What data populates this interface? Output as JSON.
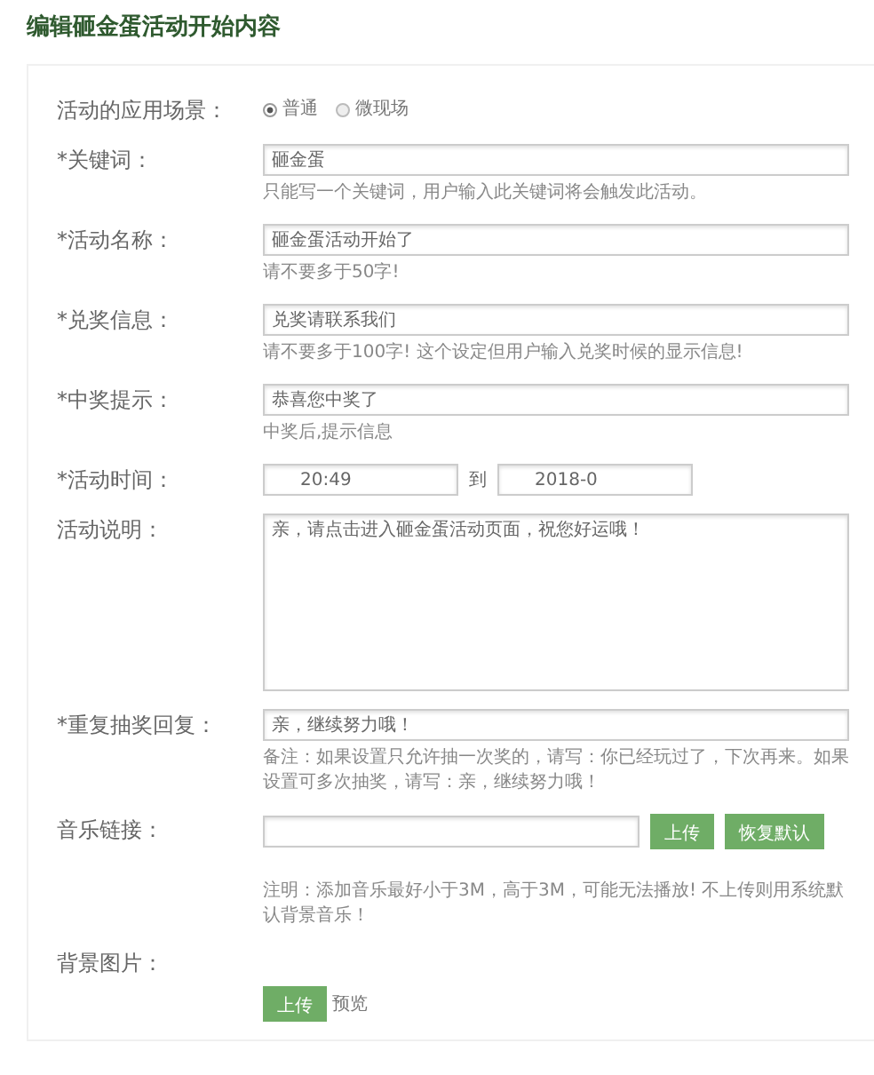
{
  "title": "编辑砸金蛋活动开始内容",
  "scene": {
    "label": "活动的应用场景：",
    "options": [
      {
        "label": "普通",
        "selected": true
      },
      {
        "label": "微现场",
        "selected": false
      }
    ]
  },
  "fields": [
    {
      "kind": "text",
      "label": "*关键词：",
      "value": "砸金蛋",
      "hint": "只能写一个关键词，用户输入此关键词将会触发此活动。"
    },
    {
      "kind": "text",
      "label": "*活动名称：",
      "value": "砸金蛋活动开始了",
      "hint": "请不要多于50字!"
    },
    {
      "kind": "text",
      "label": "*兑奖信息：",
      "value": "兑奖请联系我们",
      "hint": "请不要多于100字! 这个设定但用户输入兑奖时候的显示信息!"
    },
    {
      "kind": "text",
      "label": "*中奖提示：",
      "value": "恭喜您中奖了",
      "hint": "中奖后,提示信息"
    },
    {
      "kind": "time",
      "label": "*活动时间：",
      "start": "20:49",
      "separator": "到",
      "end": "2018-0"
    },
    {
      "kind": "textarea",
      "label": "活动说明：",
      "value": "亲，请点击进入砸金蛋活动页面，祝您好运哦！"
    },
    {
      "kind": "text",
      "label": "*重复抽奖回复：",
      "value": "亲，继续努力哦！",
      "hint": "备注：如果设置只允许抽一次奖的，请写：你已经玩过了，下次再来。如果设置可多次抽奖，请写：亲，继续努力哦！"
    },
    {
      "kind": "music",
      "label": "音乐链接：",
      "buttons": [
        "上传",
        "恢复默认"
      ],
      "hint": "注明：添加音乐最好小于3M，高于3M，可能无法播放!  不上传则用系统默认背景音乐！"
    },
    {
      "kind": "image",
      "label": "背景图片：",
      "button": "上传",
      "link": "预览"
    }
  ]
}
